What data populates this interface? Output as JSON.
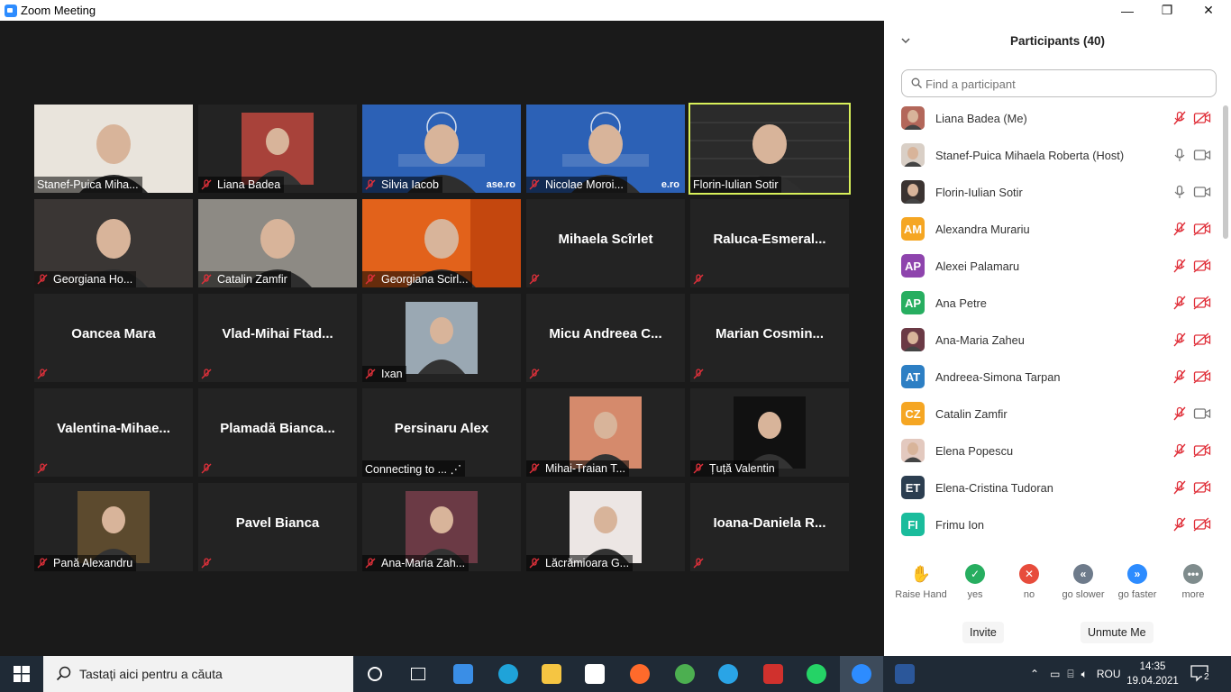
{
  "window": {
    "title": "Zoom Meeting",
    "minimize": "—",
    "maximize": "❐",
    "close": "✕"
  },
  "tiles": [
    {
      "name": "Stanef-Puica Miha...",
      "muted": false,
      "kind": "video",
      "bg": "#e9e4dc"
    },
    {
      "name": "Liana Badea",
      "muted": true,
      "kind": "photo",
      "bg": "#a8423a"
    },
    {
      "name": "Silvia Iacob",
      "muted": true,
      "kind": "video",
      "bg": "#2c61b6",
      "overlay": "ase.ro"
    },
    {
      "name": "Nicolae Moroi...",
      "muted": true,
      "kind": "video",
      "bg": "#2c61b6",
      "overlay": "e.ro"
    },
    {
      "name": "Florin-Iulian Sotir",
      "muted": false,
      "kind": "video",
      "bg": "#2b2b2b",
      "active": true
    },
    {
      "name": "Georgiana Ho...",
      "muted": true,
      "kind": "video",
      "bg": "#3a3634"
    },
    {
      "name": "Catalin Zamfir",
      "muted": true,
      "kind": "video",
      "bg": "#8d8a84"
    },
    {
      "name": "Georgiana Scirl...",
      "muted": true,
      "kind": "video",
      "bg": "#e2621b"
    },
    {
      "center": "Mihaela Scîrlet",
      "muted": true,
      "kind": "text"
    },
    {
      "center": "Raluca-Esmeral...",
      "muted": true,
      "kind": "text"
    },
    {
      "center": "Oancea Mara",
      "muted": true,
      "kind": "text"
    },
    {
      "center": "Vlad-Mihai  Ftad...",
      "muted": true,
      "kind": "text"
    },
    {
      "name": "Ixan",
      "muted": true,
      "kind": "photo",
      "bg": "#9aa8b3"
    },
    {
      "center": "Micu  Andreea  C...",
      "muted": true,
      "kind": "text"
    },
    {
      "center": "Marian  Cosmin...",
      "muted": true,
      "kind": "text"
    },
    {
      "center": "Valentina-Mihae...",
      "muted": true,
      "kind": "text"
    },
    {
      "center": "Plamadă  Bianca...",
      "muted": true,
      "kind": "text"
    },
    {
      "center": "Persinaru Alex",
      "muted": false,
      "kind": "text",
      "status": "Connecting to ...  ⋰"
    },
    {
      "name": "Mihai-Traian T...",
      "muted": true,
      "kind": "photo",
      "bg": "#d58a6c"
    },
    {
      "name": "Țuță Valentin",
      "muted": true,
      "kind": "photo",
      "bg": "#111111"
    },
    {
      "name": "Pană Alexandru",
      "muted": true,
      "kind": "photo",
      "bg": "#5c4a2e"
    },
    {
      "center": "Pavel Bianca",
      "muted": true,
      "kind": "text"
    },
    {
      "name": "Ana-Maria Zah...",
      "muted": true,
      "kind": "photo",
      "bg": "#6b3a45"
    },
    {
      "name": "Lăcrămioara G...",
      "muted": true,
      "kind": "photo",
      "bg": "#ece6e4"
    },
    {
      "center": "Ioana-Daniela  R...",
      "muted": true,
      "kind": "text"
    }
  ],
  "participants": {
    "title": "Participants (40)",
    "search_placeholder": "Find a participant",
    "list": [
      {
        "name": "Liana Badea (Me)",
        "avatar": "",
        "color": "#b3675a",
        "mic": "muted",
        "cam": "off"
      },
      {
        "name": "Stanef-Puica Mihaela Roberta (Host)",
        "avatar": "",
        "color": "#d9cfc6",
        "mic": "on",
        "cam": "on"
      },
      {
        "name": "Florin-Iulian Sotir",
        "avatar": "",
        "color": "#3b3331",
        "mic": "on",
        "cam": "on"
      },
      {
        "name": "Alexandra Murariu",
        "avatar": "AM",
        "color": "#f5a623",
        "mic": "muted",
        "cam": "off"
      },
      {
        "name": "Alexei Palamaru",
        "avatar": "AP",
        "color": "#8e44ad",
        "mic": "muted",
        "cam": "off"
      },
      {
        "name": "Ana Petre",
        "avatar": "AP",
        "color": "#27ae60",
        "mic": "muted",
        "cam": "off"
      },
      {
        "name": "Ana-Maria Zaheu",
        "avatar": "",
        "color": "#6b3a45",
        "mic": "muted",
        "cam": "off"
      },
      {
        "name": "Andreea-Simona Tarpan",
        "avatar": "AT",
        "color": "#2d7fc4",
        "mic": "muted",
        "cam": "off"
      },
      {
        "name": "Catalin Zamfir",
        "avatar": "CZ",
        "color": "#f5a623",
        "mic": "muted",
        "cam": "on"
      },
      {
        "name": "Elena Popescu",
        "avatar": "",
        "color": "#e3c9bf",
        "mic": "muted",
        "cam": "off"
      },
      {
        "name": "Elena-Cristina Tudoran",
        "avatar": "ET",
        "color": "#2c3e50",
        "mic": "muted",
        "cam": "off"
      },
      {
        "name": "Frimu Ion",
        "avatar": "FI",
        "color": "#1abc9c",
        "mic": "muted",
        "cam": "off"
      }
    ],
    "reactions": [
      {
        "label": "Raise Hand",
        "symbol": "✋",
        "color": "#2d8cff",
        "shape": "hand"
      },
      {
        "label": "yes",
        "symbol": "✓",
        "color": "#27ae60",
        "shape": "circle"
      },
      {
        "label": "no",
        "symbol": "✕",
        "color": "#e74c3c",
        "shape": "circle"
      },
      {
        "label": "go slower",
        "symbol": "«",
        "color": "#6e7b8b",
        "shape": "circle"
      },
      {
        "label": "go faster",
        "symbol": "»",
        "color": "#2d8cff",
        "shape": "circle"
      },
      {
        "label": "more",
        "symbol": "•••",
        "color": "#7f8c8d",
        "shape": "circle"
      }
    ],
    "invite_label": "Invite",
    "unmute_label": "Unmute Me"
  },
  "taskbar": {
    "search_text": "Tastați aici pentru a căuta",
    "language": "ROU",
    "time": "14:35",
    "date": "19.04.2021",
    "notifications": "2",
    "apps": [
      {
        "name": "cortana-icon",
        "color": "#ffffff"
      },
      {
        "name": "task-view-icon",
        "color": "#ffffff"
      },
      {
        "name": "computer-icon",
        "color": "#3a8ee6"
      },
      {
        "name": "edge-icon",
        "color": "#1fa3d9"
      },
      {
        "name": "file-explorer-icon",
        "color": "#f5c542"
      },
      {
        "name": "store-icon",
        "color": "#ffffff"
      },
      {
        "name": "firefox-icon",
        "color": "#ff6a2b"
      },
      {
        "name": "chrome-icon",
        "color": "#4caf50"
      },
      {
        "name": "ie-icon",
        "color": "#2aa4e6"
      },
      {
        "name": "app-z-icon",
        "color": "#d0312d"
      },
      {
        "name": "whatsapp-icon",
        "color": "#25d366"
      },
      {
        "name": "zoom-icon",
        "color": "#2d8cff"
      },
      {
        "name": "word-icon",
        "color": "#2b579a"
      }
    ]
  }
}
